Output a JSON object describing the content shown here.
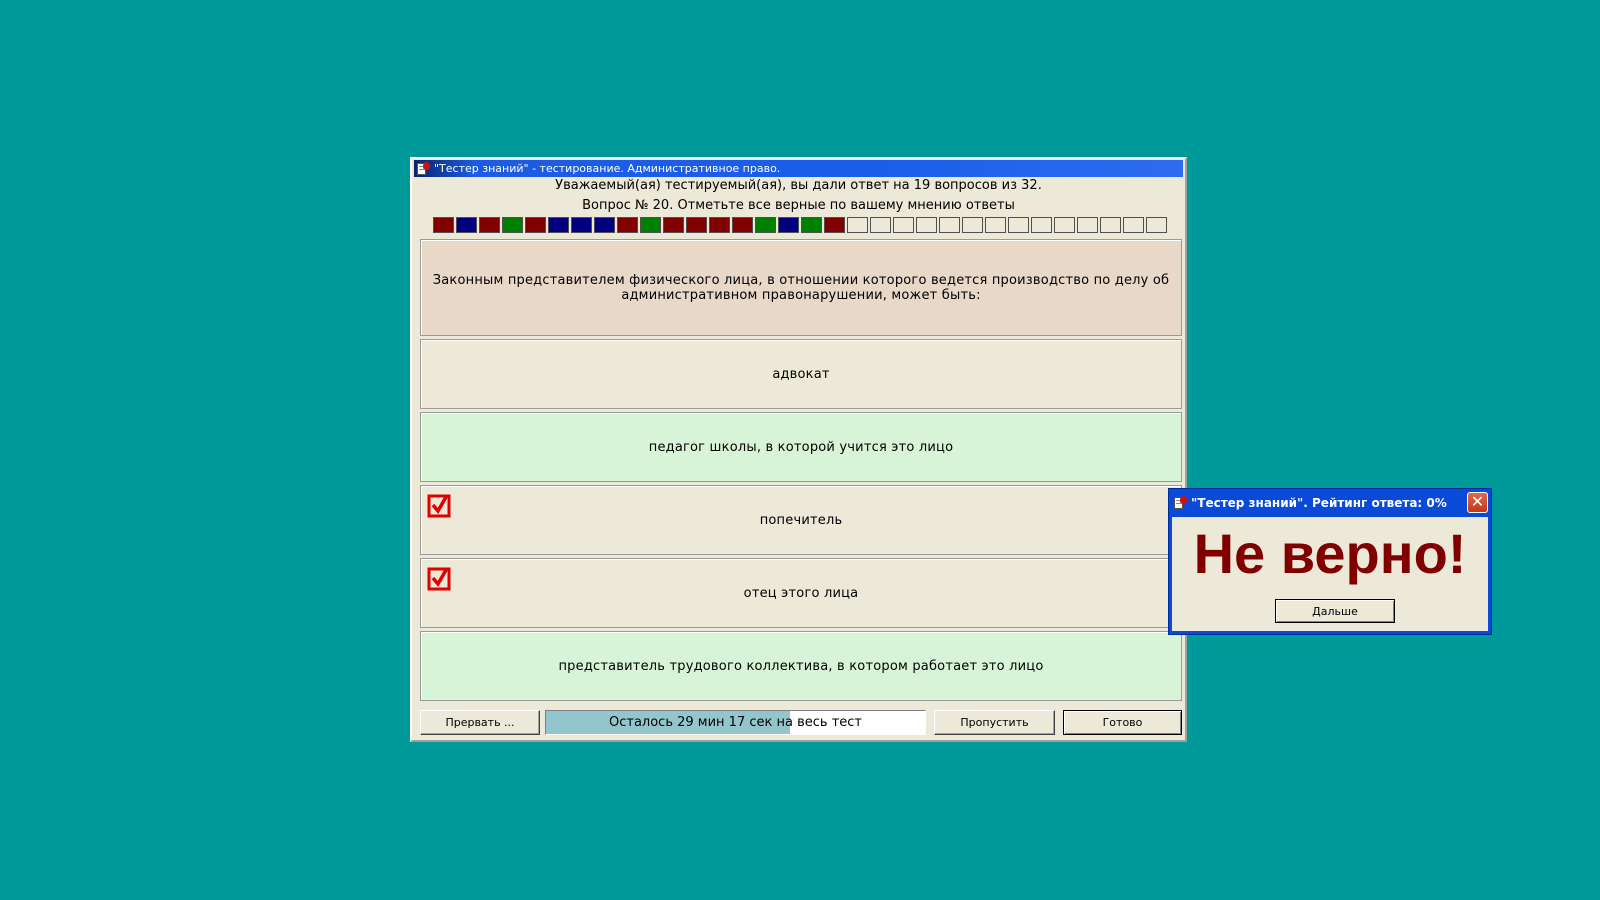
{
  "window": {
    "title": "\"Тестер знаний\" - тестирование. Административное право.",
    "status_line": "Уважаемый(ая) тестируемый(ая), вы дали ответ на 19 вопросов из 32.",
    "question_line": "Вопрос № 20. Отметьте все верные по вашему мнению ответы"
  },
  "progress": {
    "answered": 19,
    "total": 32,
    "cell_colors": [
      "#800000",
      "#000080",
      "#800000",
      "#008000",
      "#800000",
      "#000080",
      "#000080",
      "#000080",
      "#800000",
      "#008000",
      "#800000",
      "#800000",
      "#800000",
      "#800000",
      "#008000",
      "#000080",
      "#008000",
      "#800000",
      "#ece9d8",
      "#ece9d8",
      "#ece9d8",
      "#ece9d8",
      "#ece9d8",
      "#ece9d8",
      "#ece9d8",
      "#ece9d8",
      "#ece9d8",
      "#ece9d8",
      "#ece9d8",
      "#ece9d8",
      "#ece9d8",
      "#ece9d8"
    ]
  },
  "question": {
    "text": "Законным представителем физического лица, в отношении которого ведется производство по делу об административном правонарушении, может быть:",
    "background": "#e8d8c8"
  },
  "answers": [
    {
      "label": "адвокат",
      "checked": false,
      "background": "#ece9d8"
    },
    {
      "label": "педагог школы, в которой учится это лицо",
      "checked": false,
      "background": "#d8f4d8"
    },
    {
      "label": "попечитель",
      "checked": true,
      "background": "#ece9d8"
    },
    {
      "label": "отец этого лица",
      "checked": true,
      "background": "#ece9d8"
    },
    {
      "label": "представитель трудового коллектива, в котором работает это лицо",
      "checked": false,
      "background": "#d8f4d8"
    }
  ],
  "buttons": {
    "abort": "Прервать ...",
    "skip": "Пропустить",
    "done": "Готово"
  },
  "timer": {
    "text": "Осталось 29 мин 17 сек на весь тест",
    "remaining_fraction": 0.645
  },
  "dialog": {
    "title": "\"Тестер знаний\". Рейтинг ответа: 0%",
    "verdict": "Не верно!",
    "next_button": "Дальше",
    "close_icon": "close-icon"
  },
  "colors": {
    "desktop": "#009999",
    "checkmark": "#e00000",
    "verdict": "#800000"
  }
}
